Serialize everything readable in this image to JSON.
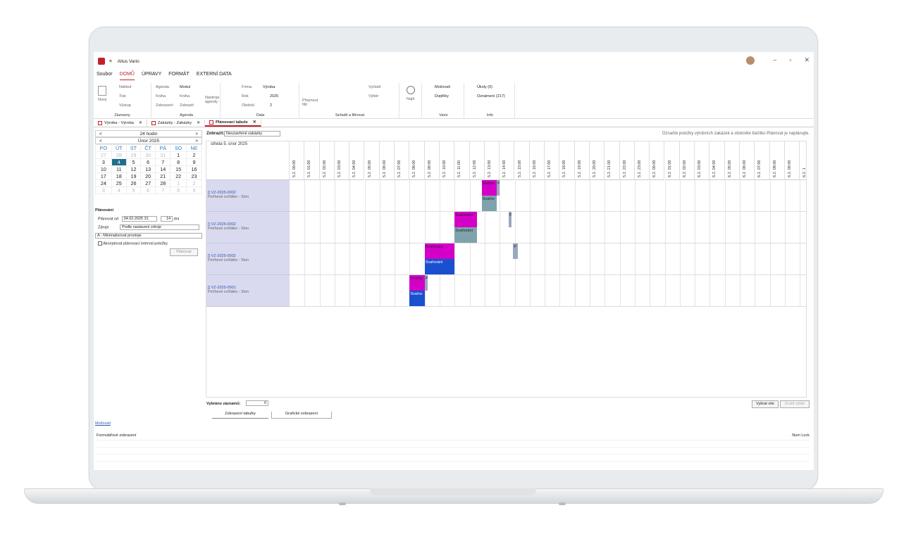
{
  "app": {
    "title": "Altus Vario"
  },
  "menu": [
    "Soubor",
    "DOMŮ",
    "ÚPRAVY",
    "FORMÁT",
    "EXTERNÍ DATA"
  ],
  "ribbon": {
    "zaznamy": {
      "novy": "Nový",
      "nahled": "Náhled",
      "tisk": "Tisk",
      "vystup": "Výstup",
      "label": "Záznamy"
    },
    "agenda": {
      "agenda": "Agenda",
      "kniha": "Kniha",
      "zobrazeni": "Zobrazení",
      "modul": "Modul",
      "kniha2": "Kniha",
      "zobrazit": "Zobrazit",
      "nastroje": "Nástroje agendy",
      "label": "Agenda"
    },
    "data": {
      "firma": "Firma",
      "firma_val": "Výroba",
      "rok": "Rok",
      "rok_val": "2025",
      "obdobi": "Období",
      "obdobi_val": "2",
      "label": "Data"
    },
    "filter": {
      "prepnout": "Přepnout filtr",
      "vycistit": "Vyčistit",
      "vyber": "Výběr",
      "label": "Seřadit a filtrovat"
    },
    "najit": "Najít",
    "vario": {
      "moznosti": "Možnosti",
      "doplnky": "Doplňky",
      "label": "Vario"
    },
    "info": {
      "ukoly": "Úkoly (0)",
      "oznameni": "Oznámení (217)",
      "label": "Info"
    }
  },
  "tabs": [
    {
      "label": "Výroba - Výroba"
    },
    {
      "label": "Zakázky - Zakázky"
    },
    {
      "label": "Plánovací tabule"
    }
  ],
  "calendar": {
    "mode": "24 hodin",
    "month": "Únor 2025",
    "days": [
      "PO",
      "ÚT",
      "ST",
      "ČT",
      "PÁ",
      "SO",
      "NE"
    ],
    "weeks": [
      [
        "27",
        "28",
        "29",
        "30",
        "31",
        "1",
        "2"
      ],
      [
        "3",
        "4",
        "5",
        "6",
        "7",
        "8",
        "9"
      ],
      [
        "10",
        "11",
        "12",
        "13",
        "14",
        "15",
        "16"
      ],
      [
        "17",
        "18",
        "19",
        "20",
        "21",
        "22",
        "23"
      ],
      [
        "24",
        "25",
        "26",
        "27",
        "28",
        "1",
        "2"
      ],
      [
        "3",
        "4",
        "5",
        "6",
        "7",
        "8",
        "9"
      ]
    ]
  },
  "planning": {
    "heading": "Plánování",
    "from_label": "Plánovat od",
    "from_value": "04.02.2025 31",
    "days_value": "14",
    "days_unit": "dní",
    "source_label": "Zdroje",
    "source_value": "Podle nastavení zdroje",
    "strategy_value": "A - Minimalizovat prostoje",
    "accept_label": "Akceptovat plánovací interval položky",
    "plan_button": "Plánovat"
  },
  "moznosti_link": "Možnosti",
  "main": {
    "show_label": "Zobrazit:",
    "show_value": "Neuzavřené zakázky",
    "hint": "Označte položky výrobních zakázek a stiskněte tlačítko Plánovat je naplánujte.",
    "date_header": "středa 5. únor 2025",
    "columns": [
      "5.2. 00:00",
      "5.2. 01:00",
      "5.2. 02:00",
      "5.2. 03:00",
      "5.2. 04:00",
      "5.2. 05:00",
      "5.2. 06:00",
      "5.2. 07:00",
      "5.2. 08:00",
      "5.2. 09:00",
      "5.2. 10:00",
      "5.2. 11:00",
      "5.2. 12:00",
      "5.2. 13:00",
      "5.2. 14:00",
      "5.2. 15:00",
      "5.2. 16:00",
      "5.2. 17:00",
      "5.2. 18:00",
      "5.2. 19:00",
      "5.2. 20:00",
      "5.2. 21:00",
      "5.2. 22:00",
      "5.2. 23:00",
      "6.2. 00:00",
      "6.2. 01:00",
      "6.2. 02:00",
      "6.2. 03:00",
      "6.2. 04:00",
      "6.2. 05:00",
      "6.2. 06:00",
      "6.2. 07:00",
      "6.2. 08:00",
      "6.2. 09:00",
      "6.2. 1"
    ],
    "rows": [
      {
        "id": "[] VZ-2025-0002",
        "desc": "Pečhevé zvířátko - Slon",
        "bars": [
          {
            "label": "Svařov",
            "start": 12.8,
            "dur": 1.0,
            "lane": 0,
            "color": "#d400c8"
          },
          {
            "label": "P",
            "start": 13.8,
            "dur": 0.2,
            "lane": 0,
            "color": "#9aa8c0"
          },
          {
            "label": "Svařov",
            "start": 12.8,
            "dur": 1.0,
            "lane": 1,
            "color": "#7ea3ad"
          }
        ]
      },
      {
        "id": "[] VZ-2025-0002",
        "desc": "Pečhevé zvířátko - Slon",
        "bars": [
          {
            "label": "Svařování",
            "start": 11.0,
            "dur": 1.5,
            "lane": 0,
            "color": "#d400c8"
          },
          {
            "label": "P",
            "start": 14.6,
            "dur": 0.2,
            "lane": 0,
            "color": "#9aa8c0"
          },
          {
            "label": "Svařování",
            "start": 11.0,
            "dur": 1.5,
            "lane": 1,
            "color": "#7ea3ad"
          }
        ]
      },
      {
        "id": "[] VZ-2025-0002",
        "desc": "Pečhevé zvířátko - Slon",
        "bars": [
          {
            "label": "Svařování",
            "start": 9.0,
            "dur": 2.0,
            "lane": 0,
            "color": "#d400c8"
          },
          {
            "label": "P",
            "start": 14.9,
            "dur": 0.3,
            "lane": 0,
            "color": "#9aa8c0"
          },
          {
            "label": "Svařování",
            "start": 9.0,
            "dur": 2.0,
            "lane": 1,
            "color": "#1a4fd0"
          }
        ]
      },
      {
        "id": "[] VZ-2025-0001",
        "desc": "Pečhevé zvířátko - Slon",
        "bars": [
          {
            "label": "Svařov",
            "start": 8.0,
            "dur": 1.0,
            "lane": 0,
            "color": "#d400c8"
          },
          {
            "label": "P",
            "start": 9.0,
            "dur": 0.2,
            "lane": 0,
            "color": "#9aa8c0"
          },
          {
            "label": "Svařov",
            "start": 8.0,
            "dur": 1.0,
            "lane": 1,
            "color": "#1a4fd0"
          }
        ]
      }
    ],
    "selected_label": "Vybráno záznamů:",
    "selected_value": "0",
    "select_all": "Vybrat vše",
    "cancel_select": "Zrušit výběr",
    "view_tabs": [
      "Zobrazení tabulky",
      "Grafické zobrazení"
    ]
  },
  "status": {
    "left": "Formulářové zobrazení",
    "right": "Num Lock"
  }
}
